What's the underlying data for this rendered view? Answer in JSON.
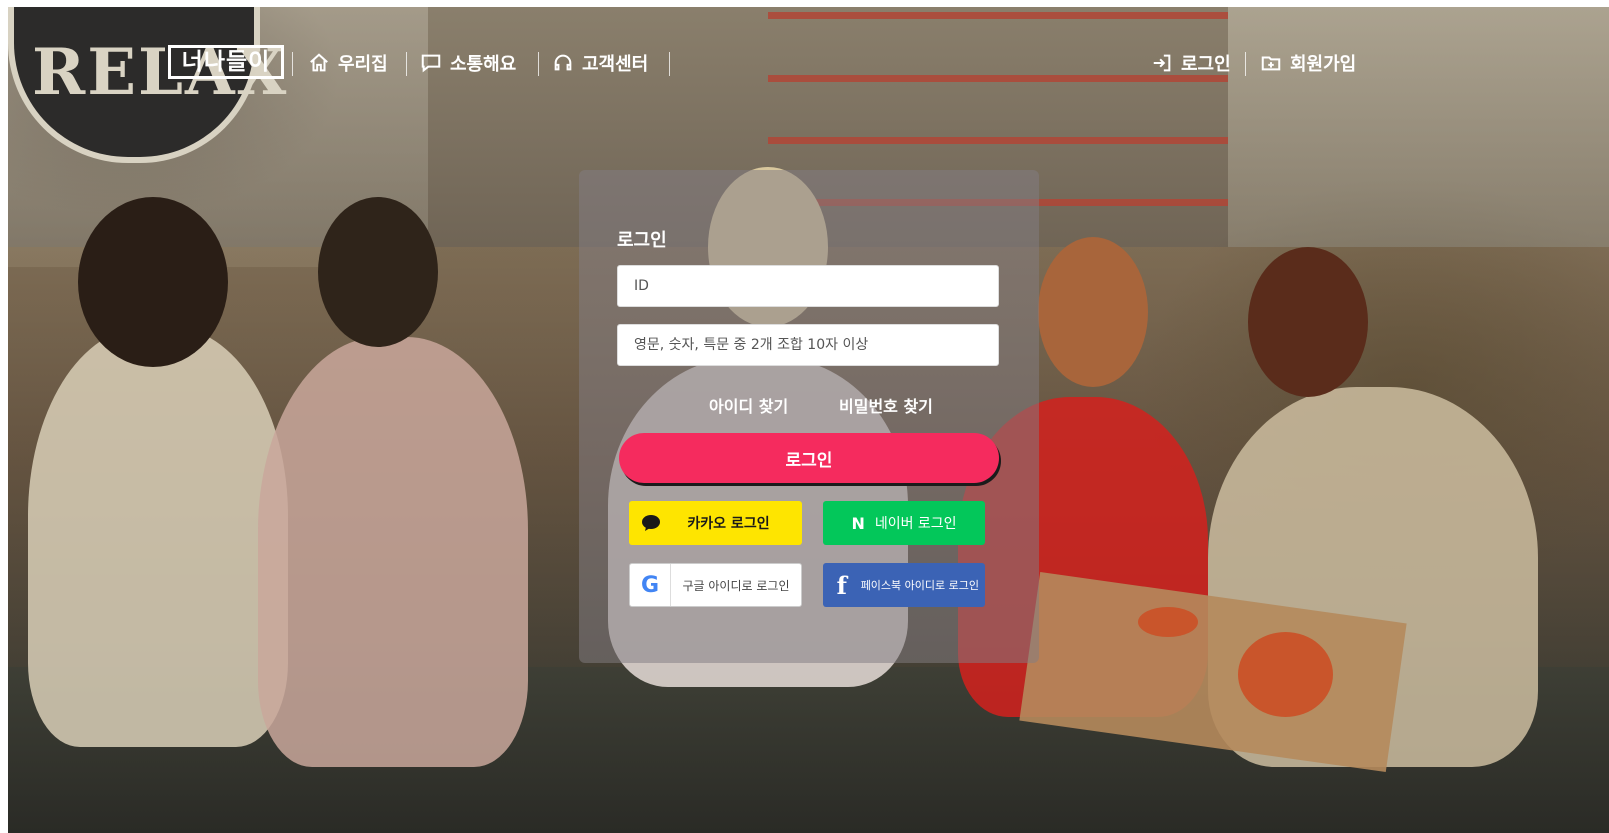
{
  "header": {
    "logo_text": "너나들이",
    "nav": [
      {
        "label": "우리집",
        "icon": "home-icon"
      },
      {
        "label": "소통해요",
        "icon": "chat-bubble-icon"
      },
      {
        "label": "고객센터",
        "icon": "headset-icon"
      }
    ],
    "auth": [
      {
        "label": "로그인",
        "icon": "sign-in-icon"
      },
      {
        "label": "회원가입",
        "icon": "folder-plus-icon"
      }
    ]
  },
  "login": {
    "title": "로그인",
    "id_placeholder": "ID",
    "password_placeholder": "영문, 숫자, 특문 중 2개 조합 10자 이상",
    "find_id": "아이디 찾기",
    "find_password": "비밀번호 찾기",
    "submit_label": "로그인",
    "social": {
      "kakao": "카카오 로그인",
      "naver": "네이버 로그인",
      "google": "구글 아이디로 로그인",
      "facebook": "페이스북 아이디로 로그인"
    }
  },
  "colors": {
    "login_button": "#f52b5e",
    "kakao": "#fee500",
    "naver": "#03c75a",
    "facebook": "#3b63b5"
  }
}
